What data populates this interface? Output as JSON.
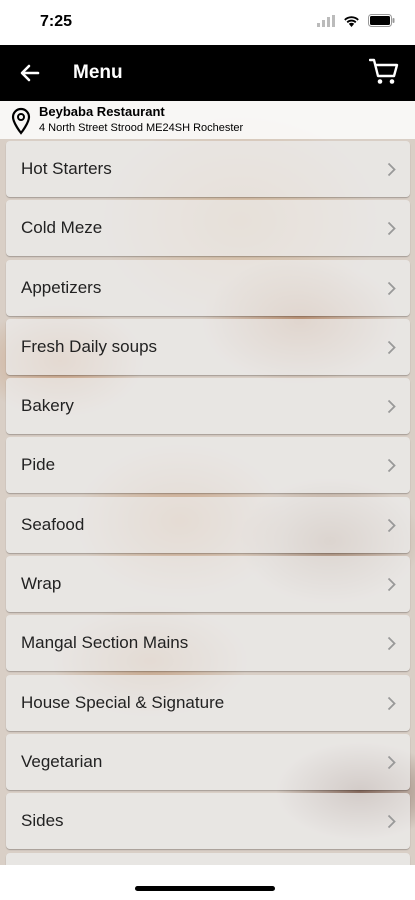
{
  "status": {
    "time": "7:25"
  },
  "header": {
    "title": "Menu"
  },
  "restaurant": {
    "name": "Beybaba Restaurant",
    "address": "4 North Street Strood ME24SH Rochester"
  },
  "menu": {
    "items": [
      {
        "label": "Hot Starters"
      },
      {
        "label": "Cold Meze"
      },
      {
        "label": "Appetizers"
      },
      {
        "label": "Fresh Daily soups"
      },
      {
        "label": "Bakery"
      },
      {
        "label": "Pide"
      },
      {
        "label": "Seafood"
      },
      {
        "label": "Wrap"
      },
      {
        "label": "Mangal Section Mains"
      },
      {
        "label": "House Special & Signature"
      },
      {
        "label": "Vegetarian"
      },
      {
        "label": "Sides"
      }
    ]
  },
  "icons": {
    "back": "arrow-left-icon",
    "cart": "cart-icon",
    "pin": "map-pin-icon",
    "chevron": "chevron-right-icon"
  },
  "colors": {
    "header_bg": "#000000",
    "item_bg": "#eeeeee"
  }
}
